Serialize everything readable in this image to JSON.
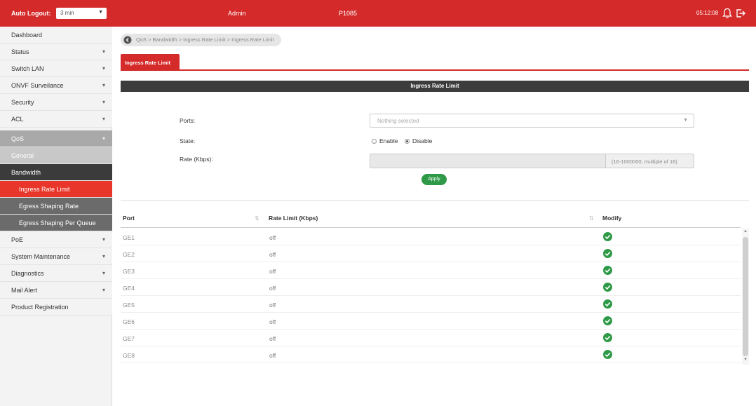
{
  "topbar": {
    "autologout_label": "Auto Logout:",
    "autologout_value": "3 min",
    "user": "Admin",
    "model": "P1085",
    "time": "05:12:08"
  },
  "sidebar": {
    "items": [
      {
        "label": "Dashboard"
      },
      {
        "label": "Status"
      },
      {
        "label": "Switch LAN"
      },
      {
        "label": "ONVF Surveilance"
      },
      {
        "label": "Security"
      },
      {
        "label": "ACL"
      },
      {
        "label": "QoS"
      },
      {
        "label": "General"
      },
      {
        "label": "Bandwidth"
      },
      {
        "label": "Ingress Rate Limit"
      },
      {
        "label": "Egress Shaping Rate"
      },
      {
        "label": "Egress Shaping Per Queue"
      },
      {
        "label": "PoE"
      },
      {
        "label": "System Maintenance"
      },
      {
        "label": "Diagnostics"
      },
      {
        "label": "Mail Alert"
      },
      {
        "label": "Product Registration"
      }
    ]
  },
  "breadcrumb": "QoS > Bandwidth > Ingress Rate Limit > Ingress Rate Limit",
  "tab_label": "Ingress Rate Limit",
  "section_title": "Ingress Rate Limit",
  "form": {
    "ports_label": "Ports:",
    "ports_placeholder": "Nothing selected",
    "state_label": "State:",
    "enable_label": "Enable",
    "disable_label": "Disable",
    "selected_state": "Disable",
    "rate_label": "Rate (Kbps):",
    "rate_hint": "(16-1000000, multiple of 16)",
    "apply_label": "Apply"
  },
  "table": {
    "headers": {
      "port": "Port",
      "rate": "Rate Limit (Kbps)",
      "modify": "Modify"
    },
    "rows": [
      {
        "port": "GE1",
        "rate": "off"
      },
      {
        "port": "GE2",
        "rate": "off"
      },
      {
        "port": "GE3",
        "rate": "off"
      },
      {
        "port": "GE4",
        "rate": "off"
      },
      {
        "port": "GE5",
        "rate": "off"
      },
      {
        "port": "GE6",
        "rate": "off"
      },
      {
        "port": "GE7",
        "rate": "off"
      },
      {
        "port": "GE8",
        "rate": "off"
      }
    ]
  },
  "colors": {
    "brand_red": "#d42a2a",
    "active_item": "#e8362b",
    "apply_green": "#2e9a47"
  }
}
